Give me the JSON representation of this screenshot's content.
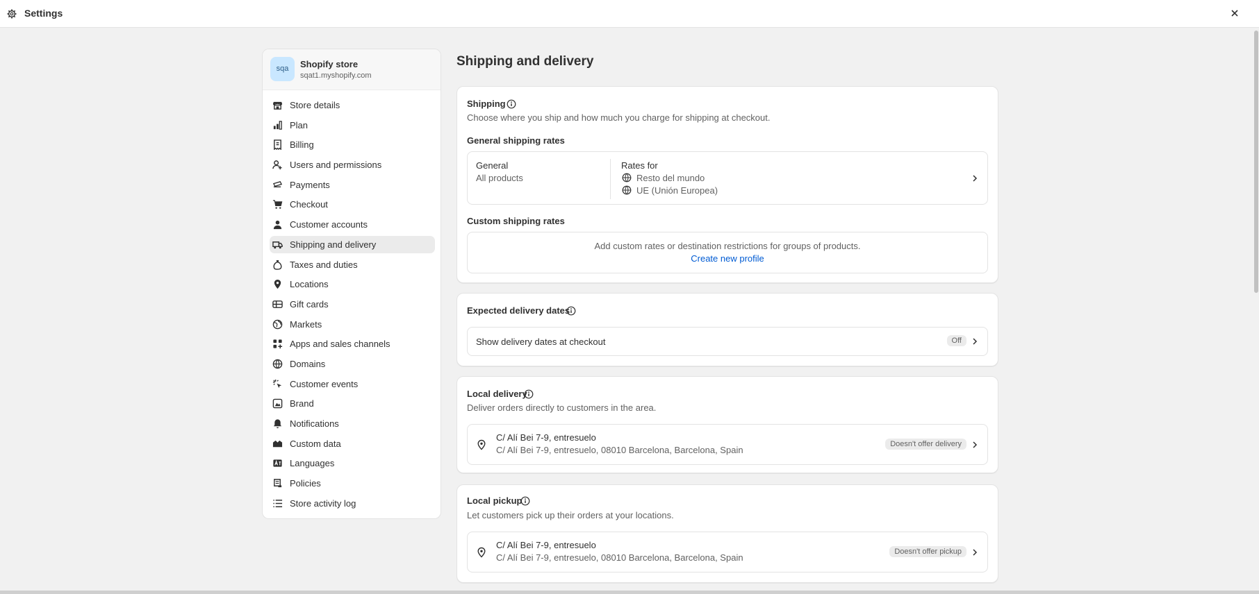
{
  "window": {
    "title": "Settings",
    "close_icon": "close-icon",
    "settings_icon": "gear-icon"
  },
  "store": {
    "avatar_text": "sqa",
    "name": "Shopify store",
    "url": "sqat1.myshopify.com"
  },
  "sidebar": {
    "items": [
      {
        "label": "Store details",
        "icon": "store-icon"
      },
      {
        "label": "Plan",
        "icon": "plan-icon"
      },
      {
        "label": "Billing",
        "icon": "billing-icon"
      },
      {
        "label": "Users and permissions",
        "icon": "users-icon"
      },
      {
        "label": "Payments",
        "icon": "payments-icon"
      },
      {
        "label": "Checkout",
        "icon": "cart-icon"
      },
      {
        "label": "Customer accounts",
        "icon": "person-icon"
      },
      {
        "label": "Shipping and delivery",
        "icon": "truck-icon",
        "active": true
      },
      {
        "label": "Taxes and duties",
        "icon": "tax-icon"
      },
      {
        "label": "Locations",
        "icon": "location-icon"
      },
      {
        "label": "Gift cards",
        "icon": "gift-card-icon"
      },
      {
        "label": "Markets",
        "icon": "globe-icon"
      },
      {
        "label": "Apps and sales channels",
        "icon": "apps-icon"
      },
      {
        "label": "Domains",
        "icon": "domains-icon"
      },
      {
        "label": "Customer events",
        "icon": "cursor-icon"
      },
      {
        "label": "Brand",
        "icon": "brand-icon"
      },
      {
        "label": "Notifications",
        "icon": "bell-icon"
      },
      {
        "label": "Custom data",
        "icon": "custom-data-icon"
      },
      {
        "label": "Languages",
        "icon": "language-icon"
      },
      {
        "label": "Policies",
        "icon": "policies-icon"
      },
      {
        "label": "Store activity log",
        "icon": "list-icon"
      }
    ]
  },
  "main": {
    "title": "Shipping and delivery",
    "shipping": {
      "title": "Shipping",
      "description": "Choose where you ship and how much you charge for shipping at checkout.",
      "general_rates_title": "General shipping rates",
      "general_profile": {
        "name": "General",
        "products": "All products",
        "rates_for_label": "Rates for",
        "zones": [
          "Resto del mundo",
          "UE (Unión Europea)"
        ]
      },
      "custom_rates_title": "Custom shipping rates",
      "custom_rates_text": "Add custom rates or destination restrictions for groups of products.",
      "create_profile_link": "Create new profile"
    },
    "expected_delivery": {
      "title": "Expected delivery dates",
      "row_label": "Show delivery dates at checkout",
      "status": "Off"
    },
    "local_delivery": {
      "title": "Local delivery",
      "description": "Deliver orders directly to customers in the area.",
      "location_name": "C/ Alí Bei 7-9, entresuelo",
      "location_address": "C/ Alí Bei 7-9, entresuelo, 08010 Barcelona, Barcelona, Spain",
      "status": "Doesn't offer delivery"
    },
    "local_pickup": {
      "title": "Local pickup",
      "description": "Let customers pick up their orders at your locations.",
      "location_name": "C/ Alí Bei 7-9, entresuelo",
      "location_address": "C/ Alí Bei 7-9, entresuelo, 08010 Barcelona, Barcelona, Spain",
      "status": "Doesn't offer pickup"
    }
  }
}
